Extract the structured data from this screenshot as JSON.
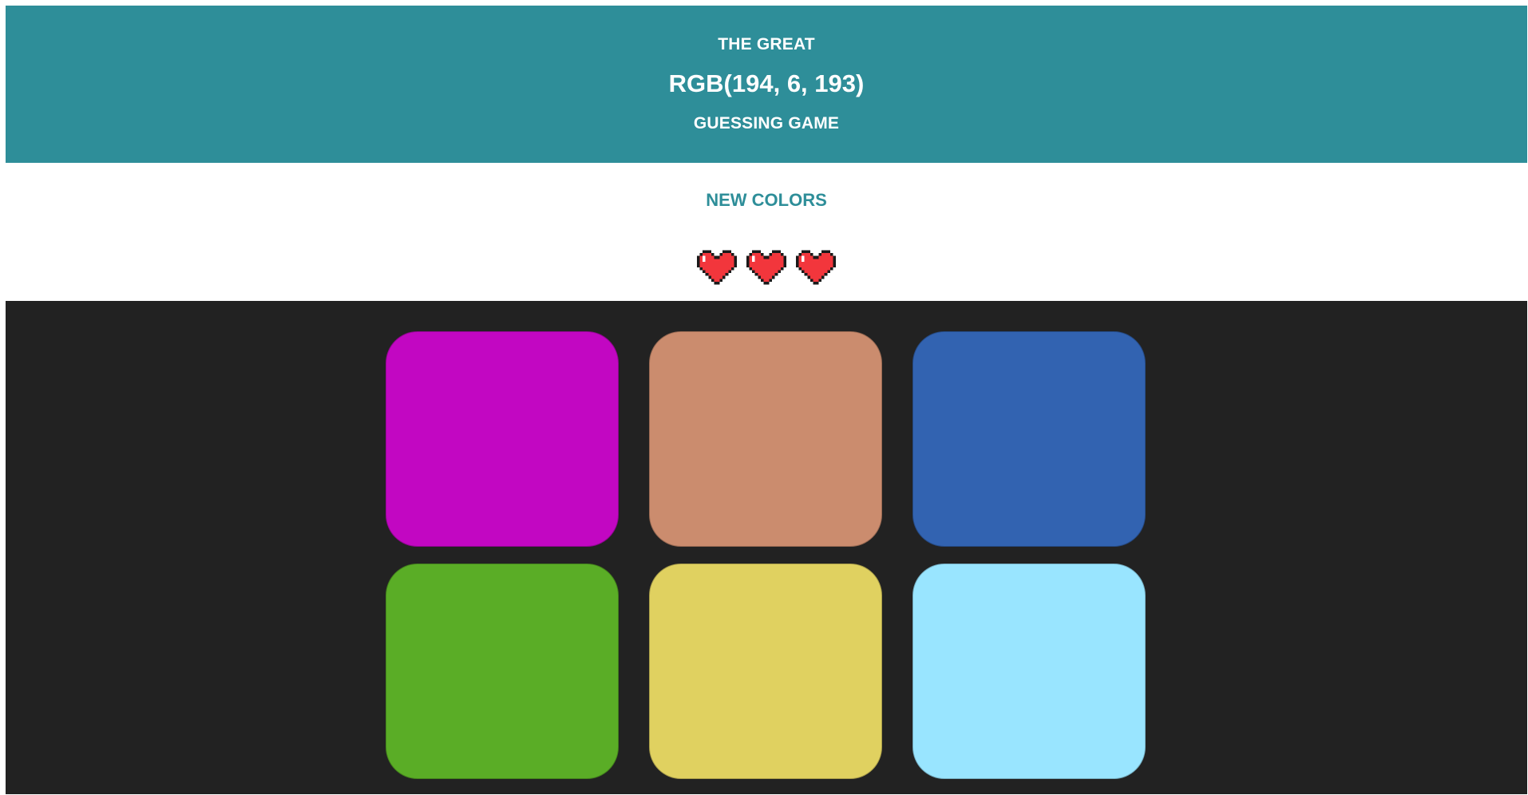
{
  "header": {
    "top_text": "THE GREAT",
    "rgb_text": "RGB(194, 6, 193)",
    "bottom_text": "GUESSING GAME",
    "background_color": "#2e8e99"
  },
  "controls": {
    "new_colors_label": "NEW COLORS",
    "lives": 3,
    "heart_icon": "pixel-heart-icon"
  },
  "board": {
    "background_color": "#222222",
    "squares": [
      {
        "color": "#c207c2"
      },
      {
        "color": "#cb8c6e"
      },
      {
        "color": "#3263b1"
      },
      {
        "color": "#5aad26"
      },
      {
        "color": "#e0d160"
      },
      {
        "color": "#99e5ff"
      }
    ]
  }
}
